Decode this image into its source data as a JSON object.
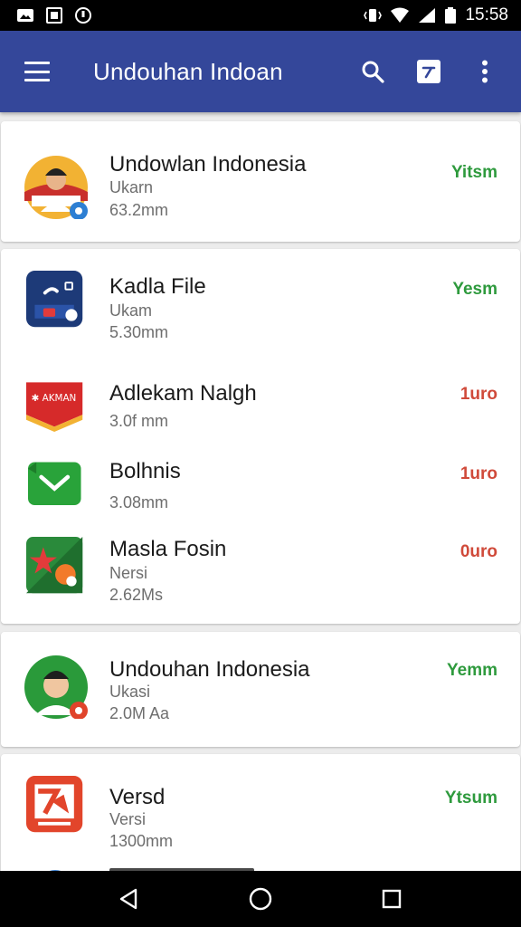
{
  "status_bar": {
    "time": "15:58",
    "icons": [
      "image-icon",
      "photo-icon",
      "dnd-icon",
      "vibrate-icon",
      "wifi-icon",
      "signal-icon",
      "battery-icon"
    ]
  },
  "app_bar": {
    "title": "Undouhan Indoan",
    "actions": [
      "search-icon",
      "edit-icon",
      "more-vert-icon"
    ],
    "color": "#34479a"
  },
  "apps": [
    {
      "name": "Undowlan Indonesia",
      "sub": "Ukarn",
      "size": "63.2mm",
      "status": "Yitsm",
      "status_color": "green"
    },
    {
      "name": "Kadla File",
      "sub": "Ukam",
      "size": "5.30mm",
      "status": "Yesm",
      "status_color": "green"
    },
    {
      "name": "Adlekam Nalgh",
      "sub": "",
      "size": "3.0f mm",
      "status": "1uro",
      "status_color": "red"
    },
    {
      "name": "Bolhnis",
      "sub": "",
      "size": "3.08mm",
      "status": "1uro",
      "status_color": "red"
    },
    {
      "name": "Masla Fosin",
      "sub": "Nersi",
      "size": "2.62Ms",
      "status": "0uro",
      "status_color": "red"
    },
    {
      "name": "Undouhan Indonesia",
      "sub": "Ukasi",
      "size": "2.0M Aa",
      "status": "Yemm",
      "status_color": "green"
    },
    {
      "name": "Versd",
      "sub": "Versi",
      "size": "1300mm",
      "status": "Ytsum",
      "status_color": "green"
    }
  ],
  "nav": [
    "back-icon",
    "home-icon",
    "recents-icon"
  ],
  "colors": {
    "accent": "#34479a",
    "installed": "#2e9a3d",
    "update": "#d04a3a"
  }
}
